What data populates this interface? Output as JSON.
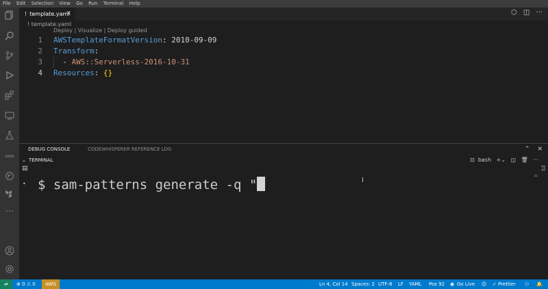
{
  "menu": [
    "File",
    "Edit",
    "Selection",
    "View",
    "Go",
    "Run",
    "Terminal",
    "Help"
  ],
  "tab": {
    "label": "template.yaml",
    "prefix": "!",
    "close": "✕"
  },
  "breadcrumb": "! template.yaml",
  "codelens": "Deploy | Visualize | Deploy guided",
  "code_lines": [
    {
      "num": "1",
      "key": "AWSTemplateFormatVersion",
      "sep": ": ",
      "value": "2010-09-09"
    },
    {
      "num": "2",
      "key": "Transform",
      "sep": ":",
      "value": ""
    },
    {
      "num": "3",
      "key": "",
      "sep": "  - ",
      "value": "AWS::Serverless-2016-10-31"
    },
    {
      "num": "4",
      "key": "Resources",
      "sep": ": ",
      "value": "{}"
    }
  ],
  "panel": {
    "tab_debug": "DEBUG CONSOLE",
    "tab_codewhisperer": "CODEWHISPERER REFERENCE LOG",
    "section": "TERMINAL",
    "shell": "bash"
  },
  "terminal": {
    "prompt": "$ sam-patterns generate -q \""
  },
  "status": {
    "remote": "⇌",
    "problems": "⊗ 0 ⚠ 0",
    "aws": "AWS",
    "position": "Ln 4, Col 14",
    "spaces": "Spaces: 2",
    "encoding": "UTF-8",
    "eol": "LF",
    "language": "YAML",
    "pos": "Pos 92",
    "golive": "Go Live",
    "prettier": "✓ Prettier"
  },
  "icons": [
    "files-icon",
    "search-icon",
    "source-control-icon",
    "run-debug-icon",
    "extensions-icon",
    "remote-explorer-icon",
    "testing-icon",
    "aws-icon",
    "gitlens-icon",
    "terraform-icon",
    "more-icon",
    "account-icon",
    "settings-gear-icon"
  ],
  "colors": {
    "statusbar": "#007acc",
    "aws_badge": "#c69026",
    "keyword": "#569cd6",
    "string": "#ce9178",
    "bracket": "#ffd700"
  }
}
